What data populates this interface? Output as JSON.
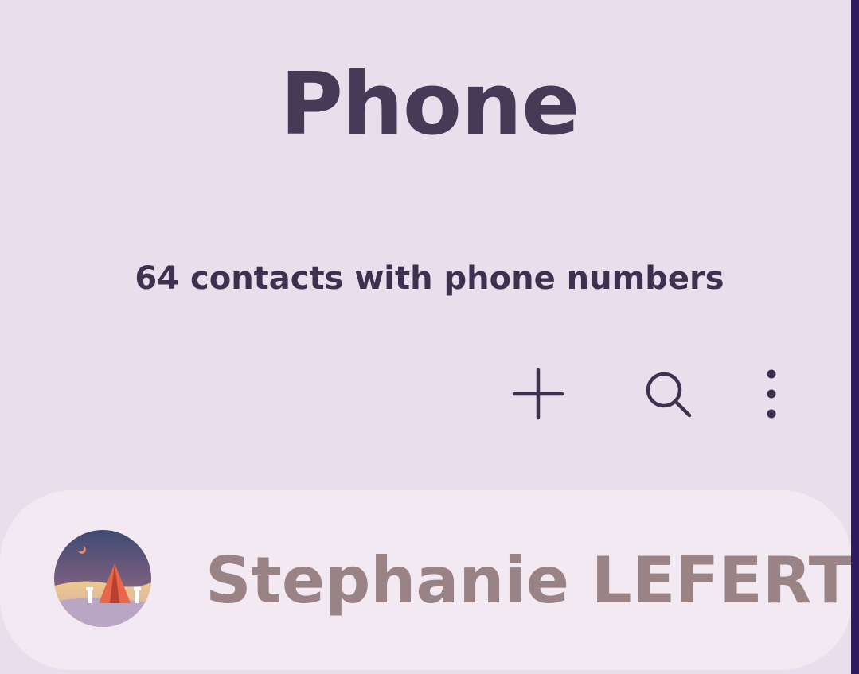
{
  "header": {
    "title": "Phone",
    "subtitle": "64 contacts with phone numbers"
  },
  "toolbar": {
    "actions": [
      {
        "icon": "plus-icon",
        "name": "add"
      },
      {
        "icon": "search-icon",
        "name": "search"
      },
      {
        "icon": "more-vert-icon",
        "name": "more options"
      }
    ]
  },
  "contacts": [
    {
      "name": "Stephanie LEFERT",
      "avatar_icon": "tent-landscape-avatar"
    }
  ],
  "colors": {
    "background": "#e7dfec",
    "title": "#463a57",
    "card": "#f3e9f3",
    "contact_name": "#9a8385",
    "edge": "#2e1a5e"
  }
}
